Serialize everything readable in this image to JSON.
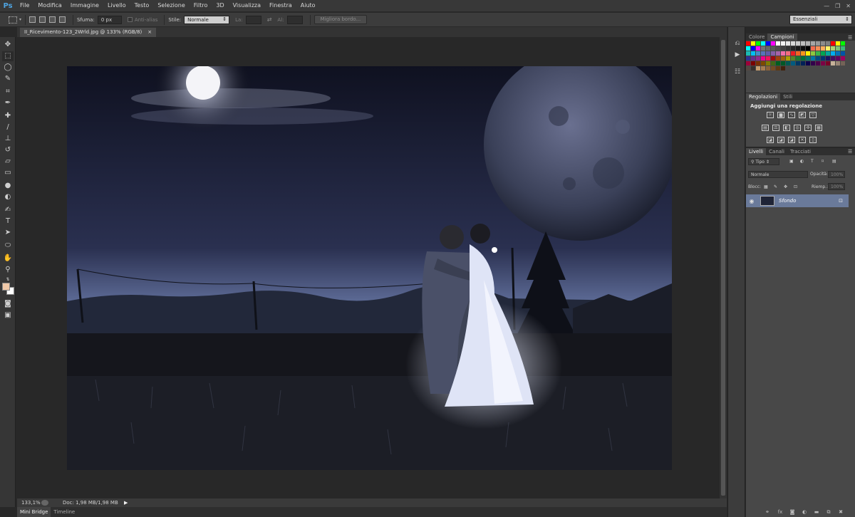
{
  "menubar": {
    "logo": "Ps",
    "items": [
      "File",
      "Modifica",
      "Immagine",
      "Livello",
      "Testo",
      "Selezione",
      "Filtro",
      "3D",
      "Visualizza",
      "Finestra",
      "Aiuto"
    ],
    "win_controls": [
      "—",
      "❐",
      "✕"
    ]
  },
  "optbar": {
    "feather_label": "Sfuma:",
    "feather_value": "0 px",
    "antialias_label": "Anti-alias",
    "style_label": "Stile:",
    "style_value": "Normale",
    "width_label": "La:",
    "height_label": "Al:",
    "refine_button": "Migliora bordo..."
  },
  "workspace": {
    "value": "Essenziali"
  },
  "document": {
    "tab_title": "II_Ricevimento-123_2Wrld.jpg @ 133% (RGB/8)",
    "tab_close": "×"
  },
  "status": {
    "zoom": "133,1%",
    "doc_info": "Doc: 1,98 MB/1,98 MB",
    "arrow": "▶"
  },
  "bottom_tabs": [
    "Mini Bridge",
    "Timeline"
  ],
  "panels": {
    "colors_tabs": [
      "Colore",
      "Campioni"
    ],
    "colors_active": 1,
    "adjust_tabs": [
      "Regolazioni",
      "Stili"
    ],
    "adjust_title": "Aggiungi una regolazione",
    "layers_tabs": [
      "Livelli",
      "Canali",
      "Tracciati"
    ],
    "kind_filter": "Tipo",
    "blend_mode": "Normale",
    "opacity_label": "Opacità:",
    "opacity_value": "100%",
    "lock_label": "Blocc:",
    "fill_label": "Riemp.:",
    "fill_value": "100%",
    "layer_name": "Sfondo"
  },
  "colors": {
    "swatch_rows": [
      [
        "#ff0000",
        "#ffff00",
        "#00ff00",
        "#00ffff",
        "#0000ff",
        "#ff00ff",
        "#ffffff",
        "#f2f2f2",
        "#e6e6e6",
        "#d9d9d9",
        "#cccccc",
        "#bfbfbf",
        "#b3b3b3",
        "#a6a6a6",
        "#999999",
        "#8c8c8c",
        "#808080",
        "#ff0000",
        "#ffff00",
        "#00ff00"
      ],
      [
        "#00ffff",
        "#0000ff",
        "#ff00ff",
        "#737373",
        "#666666",
        "#595959",
        "#4d4d4d",
        "#404040",
        "#333333",
        "#262626",
        "#1a1a1a",
        "#0d0d0d",
        "#000000",
        "#f26c4f",
        "#f68e55",
        "#fbaf5c",
        "#fff467",
        "#acd372",
        "#7cc576",
        "#3bb878"
      ],
      [
        "#1abbb4",
        "#00bff3",
        "#438cca",
        "#5574b9",
        "#605ca8",
        "#855fa8",
        "#a763a8",
        "#f06ea9",
        "#f26d7d",
        "#ed1c24",
        "#f26522",
        "#f7941d",
        "#fff200",
        "#8dc73f",
        "#39b54a",
        "#00a651",
        "#00a99d",
        "#00aeef",
        "#0072bc",
        "#0054a6"
      ],
      [
        "#2e3192",
        "#662d91",
        "#92278f",
        "#ec008c",
        "#ed145b",
        "#9e0b0f",
        "#a0410d",
        "#a3620a",
        "#aba000",
        "#598527",
        "#1a7b30",
        "#007236",
        "#00746b",
        "#0076a3",
        "#004b80",
        "#003471",
        "#1b1464",
        "#440e62",
        "#630460",
        "#9e005d"
      ],
      [
        "#9e0039",
        "#790000",
        "#7b2e00",
        "#7d4900",
        "#827b00",
        "#406618",
        "#005e20",
        "#005826",
        "#005952",
        "#005b7f",
        "#003663",
        "#002157",
        "#0d004c",
        "#32004b",
        "#4b0049",
        "#7b0046",
        "#7a0026",
        "#c7b299",
        "#998675",
        "#736357"
      ],
      [
        "#534741",
        "#37302d",
        "#c69c6d",
        "#a67c52",
        "#8c6239",
        "#754c24",
        "#603913",
        "#42210b"
      ]
    ],
    "fg_color": "#f0c8a8",
    "bg_color": "#ffffff"
  },
  "toolbar_icons": [
    "move-icon",
    "marquee-icon",
    "lasso-icon",
    "quick-select-icon",
    "crop-icon",
    "eyedropper-icon",
    "healing-icon",
    "brush-icon",
    "clone-stamp-icon",
    "history-brush-icon",
    "eraser-icon",
    "gradient-icon",
    "blur-icon",
    "dodge-icon",
    "pen-icon",
    "type-icon",
    "path-select-icon",
    "ellipse-icon",
    "hand-icon",
    "zoom-icon"
  ]
}
